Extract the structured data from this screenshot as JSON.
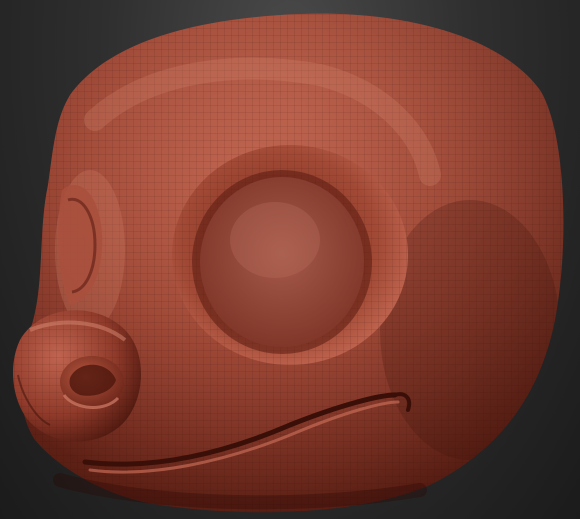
{
  "scene": {
    "subject_icon": "sculpt-head-model-icon",
    "colors": {
      "background_light": "#4a4a4a",
      "background_dark": "#1b1b1b",
      "clay_base": "#8e3a2a",
      "clay_light": "#c9705a",
      "clay_dark": "#3e120b"
    },
    "wireframe_visible": true
  }
}
